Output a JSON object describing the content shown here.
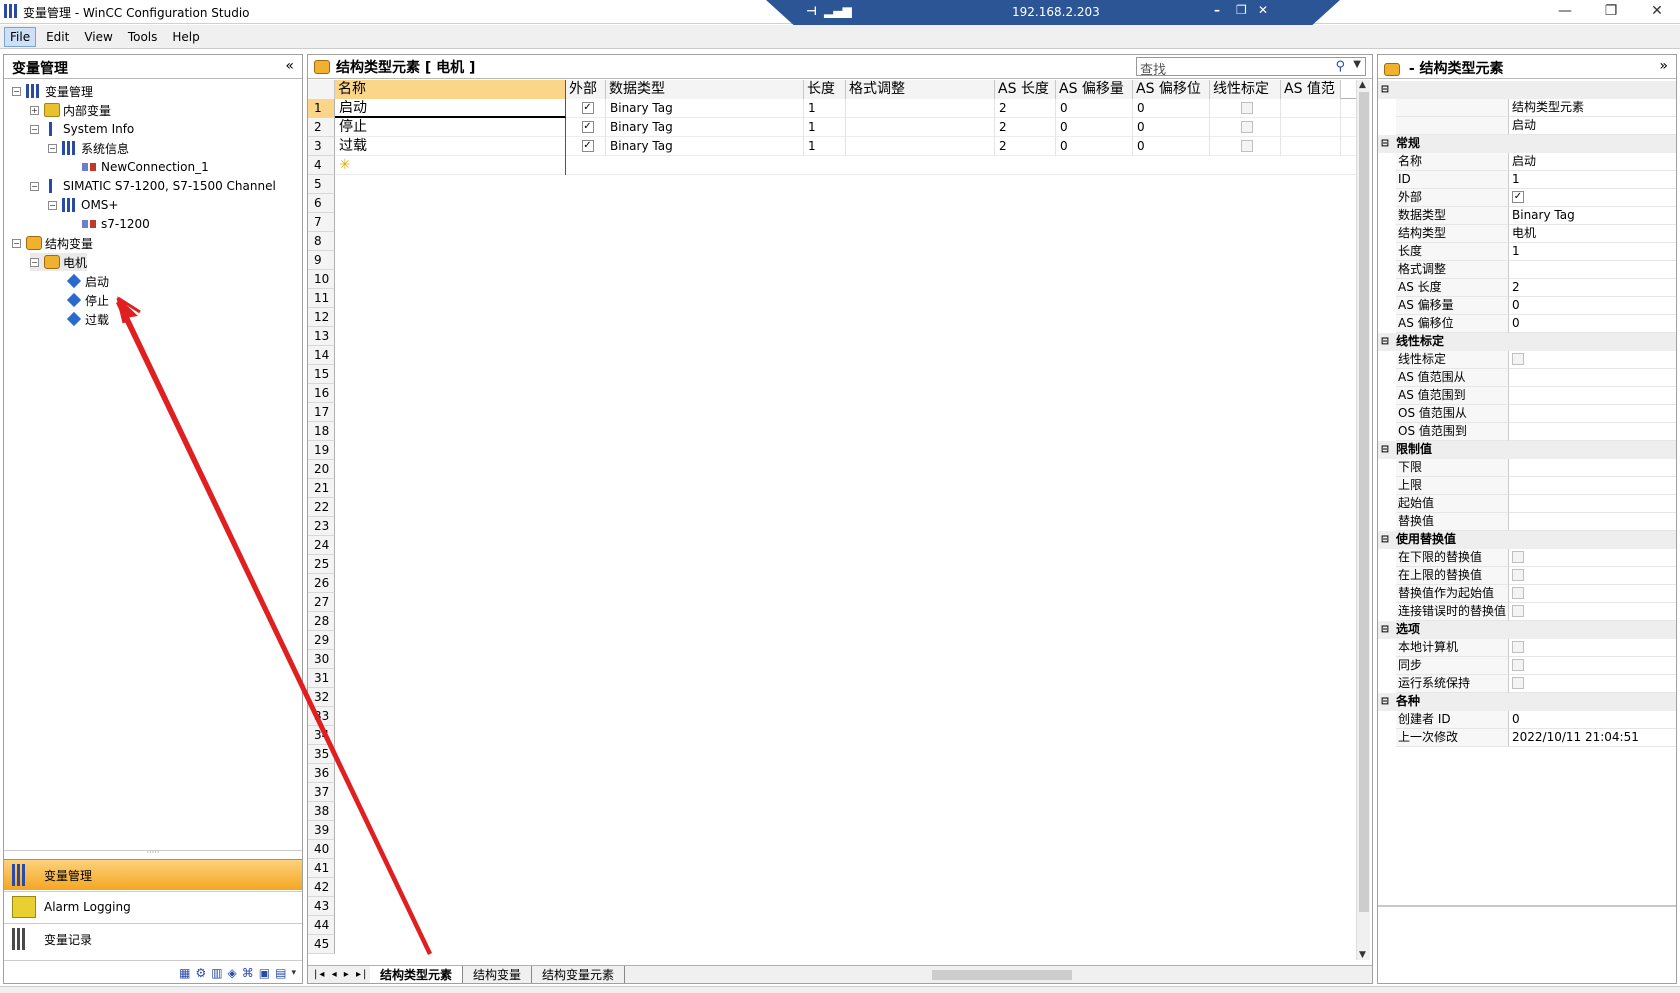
{
  "window": {
    "title": "变量管理 - WinCC Configuration Studio"
  },
  "remote": {
    "ip": "192.168.2.203"
  },
  "menu": [
    "File",
    "Edit",
    "View",
    "Tools",
    "Help"
  ],
  "left": {
    "header": "变量管理",
    "collapse": "«",
    "tree": [
      "变量管理",
      "内部变量",
      "System Info",
      "系统信息",
      "NewConnection_1",
      "SIMATIC S7-1200, S7-1500 Channel",
      "OMS+",
      "s7-1200",
      "结构变量",
      "电机",
      "启动",
      "停止",
      "过载"
    ],
    "nav": [
      "变量管理",
      "Alarm Logging",
      "变量记录"
    ]
  },
  "grid": {
    "title": "结构类型元素 [ 电机 ]",
    "search_placeholder": "查找",
    "columns": [
      "名称",
      "外部",
      "数据类型",
      "长度",
      "格式调整",
      "AS 长度",
      "AS 偏移量",
      "AS 偏移位",
      "线性标定",
      "AS 值范"
    ],
    "rows": [
      {
        "name": "启动",
        "external": true,
        "type": "Binary Tag",
        "length": "1",
        "format": "",
        "as_len": "2",
        "as_offset": "0",
        "as_bit": "0",
        "linear": false
      },
      {
        "name": "停止",
        "external": true,
        "type": "Binary Tag",
        "length": "1",
        "format": "",
        "as_len": "2",
        "as_offset": "0",
        "as_bit": "0",
        "linear": false
      },
      {
        "name": "过载",
        "external": true,
        "type": "Binary Tag",
        "length": "1",
        "format": "",
        "as_len": "2",
        "as_offset": "0",
        "as_bit": "0",
        "linear": false
      }
    ],
    "row_count": 45,
    "tabs": [
      "结构类型元素",
      "结构变量",
      "结构变量元素"
    ]
  },
  "props": {
    "header": "- 结构类型元素",
    "collapse": "»",
    "top": [
      {
        "k": "",
        "v": "结构类型元素"
      },
      {
        "k": "",
        "v": "启动"
      }
    ],
    "sections": [
      {
        "name": "常规",
        "items": [
          {
            "k": "名称",
            "v": "启动"
          },
          {
            "k": "ID",
            "v": "1"
          },
          {
            "k": "外部",
            "v": "☑"
          },
          {
            "k": "数据类型",
            "v": "Binary Tag"
          },
          {
            "k": "结构类型",
            "v": "电机"
          },
          {
            "k": "长度",
            "v": "1"
          },
          {
            "k": "格式调整",
            "v": ""
          },
          {
            "k": "AS 长度",
            "v": "2"
          },
          {
            "k": "AS 偏移量",
            "v": "0"
          },
          {
            "k": "AS 偏移位",
            "v": "0"
          }
        ]
      },
      {
        "name": "线性标定",
        "items": [
          {
            "k": "线性标定",
            "v": "☐"
          },
          {
            "k": "AS 值范围从",
            "v": ""
          },
          {
            "k": "AS 值范围到",
            "v": ""
          },
          {
            "k": "OS 值范围从",
            "v": ""
          },
          {
            "k": "OS 值范围到",
            "v": ""
          }
        ]
      },
      {
        "name": "限制值",
        "items": [
          {
            "k": "下限",
            "v": ""
          },
          {
            "k": "上限",
            "v": ""
          },
          {
            "k": "起始值",
            "v": ""
          },
          {
            "k": "替换值",
            "v": ""
          }
        ]
      },
      {
        "name": "使用替换值",
        "items": [
          {
            "k": "在下限的替换值",
            "v": "☐"
          },
          {
            "k": "在上限的替换值",
            "v": "☐"
          },
          {
            "k": "替换值作为起始值",
            "v": "☐"
          },
          {
            "k": "连接错误时的替换值",
            "v": "☐"
          }
        ]
      },
      {
        "name": "选项",
        "items": [
          {
            "k": "本地计算机",
            "v": "☐"
          },
          {
            "k": "同步",
            "v": "☐"
          },
          {
            "k": "运行系统保持",
            "v": "☐"
          }
        ]
      },
      {
        "name": "各种",
        "items": [
          {
            "k": "创建者 ID",
            "v": "0"
          },
          {
            "k": "上一次修改",
            "v": "2022/10/11 21:04:51"
          }
        ]
      }
    ]
  },
  "colors": {
    "accent": "#f5a623",
    "selection": "#fbd68a",
    "arrow": "#e02020"
  }
}
